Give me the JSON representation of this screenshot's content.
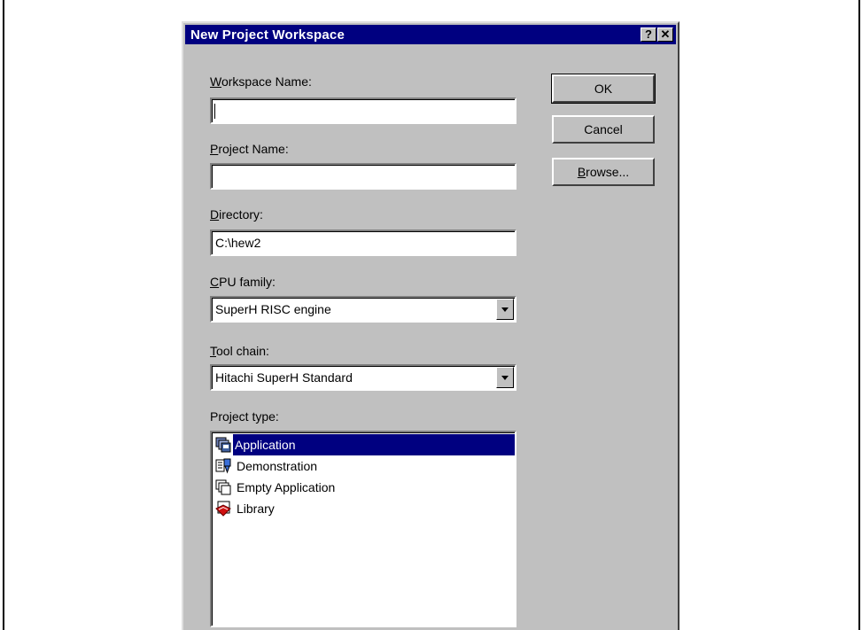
{
  "dialog": {
    "title": "New Project Workspace",
    "help_button": "?",
    "close_button": "✕"
  },
  "fields": {
    "workspace_name": {
      "label_ul": "W",
      "label_rest": "orkspace Name:",
      "value": ""
    },
    "project_name": {
      "label_ul": "P",
      "label_rest": "roject Name:",
      "value": ""
    },
    "directory": {
      "label_ul": "D",
      "label_rest": "irectory:",
      "value": "C:\\hew2"
    },
    "cpu_family": {
      "label_ul": "C",
      "label_rest": "PU family:",
      "value": "SuperH RISC engine"
    },
    "tool_chain": {
      "label_ul": "T",
      "label_rest": "ool chain:",
      "value": "Hitachi SuperH Standard"
    }
  },
  "project_type": {
    "label": "Project type:",
    "items": [
      {
        "label": "Application",
        "icon": "application-icon",
        "selected": true
      },
      {
        "label": "Demonstration",
        "icon": "demonstration-icon",
        "selected": false
      },
      {
        "label": "Empty Application",
        "icon": "empty-application-icon",
        "selected": false
      },
      {
        "label": "Library",
        "icon": "library-icon",
        "selected": false
      }
    ]
  },
  "buttons": {
    "ok": "OK",
    "cancel": "Cancel",
    "browse_ul": "B",
    "browse_rest": "rowse..."
  },
  "colors": {
    "titlebar": "#000080",
    "dialog_face": "#c0c0c0",
    "selection": "#000080"
  }
}
